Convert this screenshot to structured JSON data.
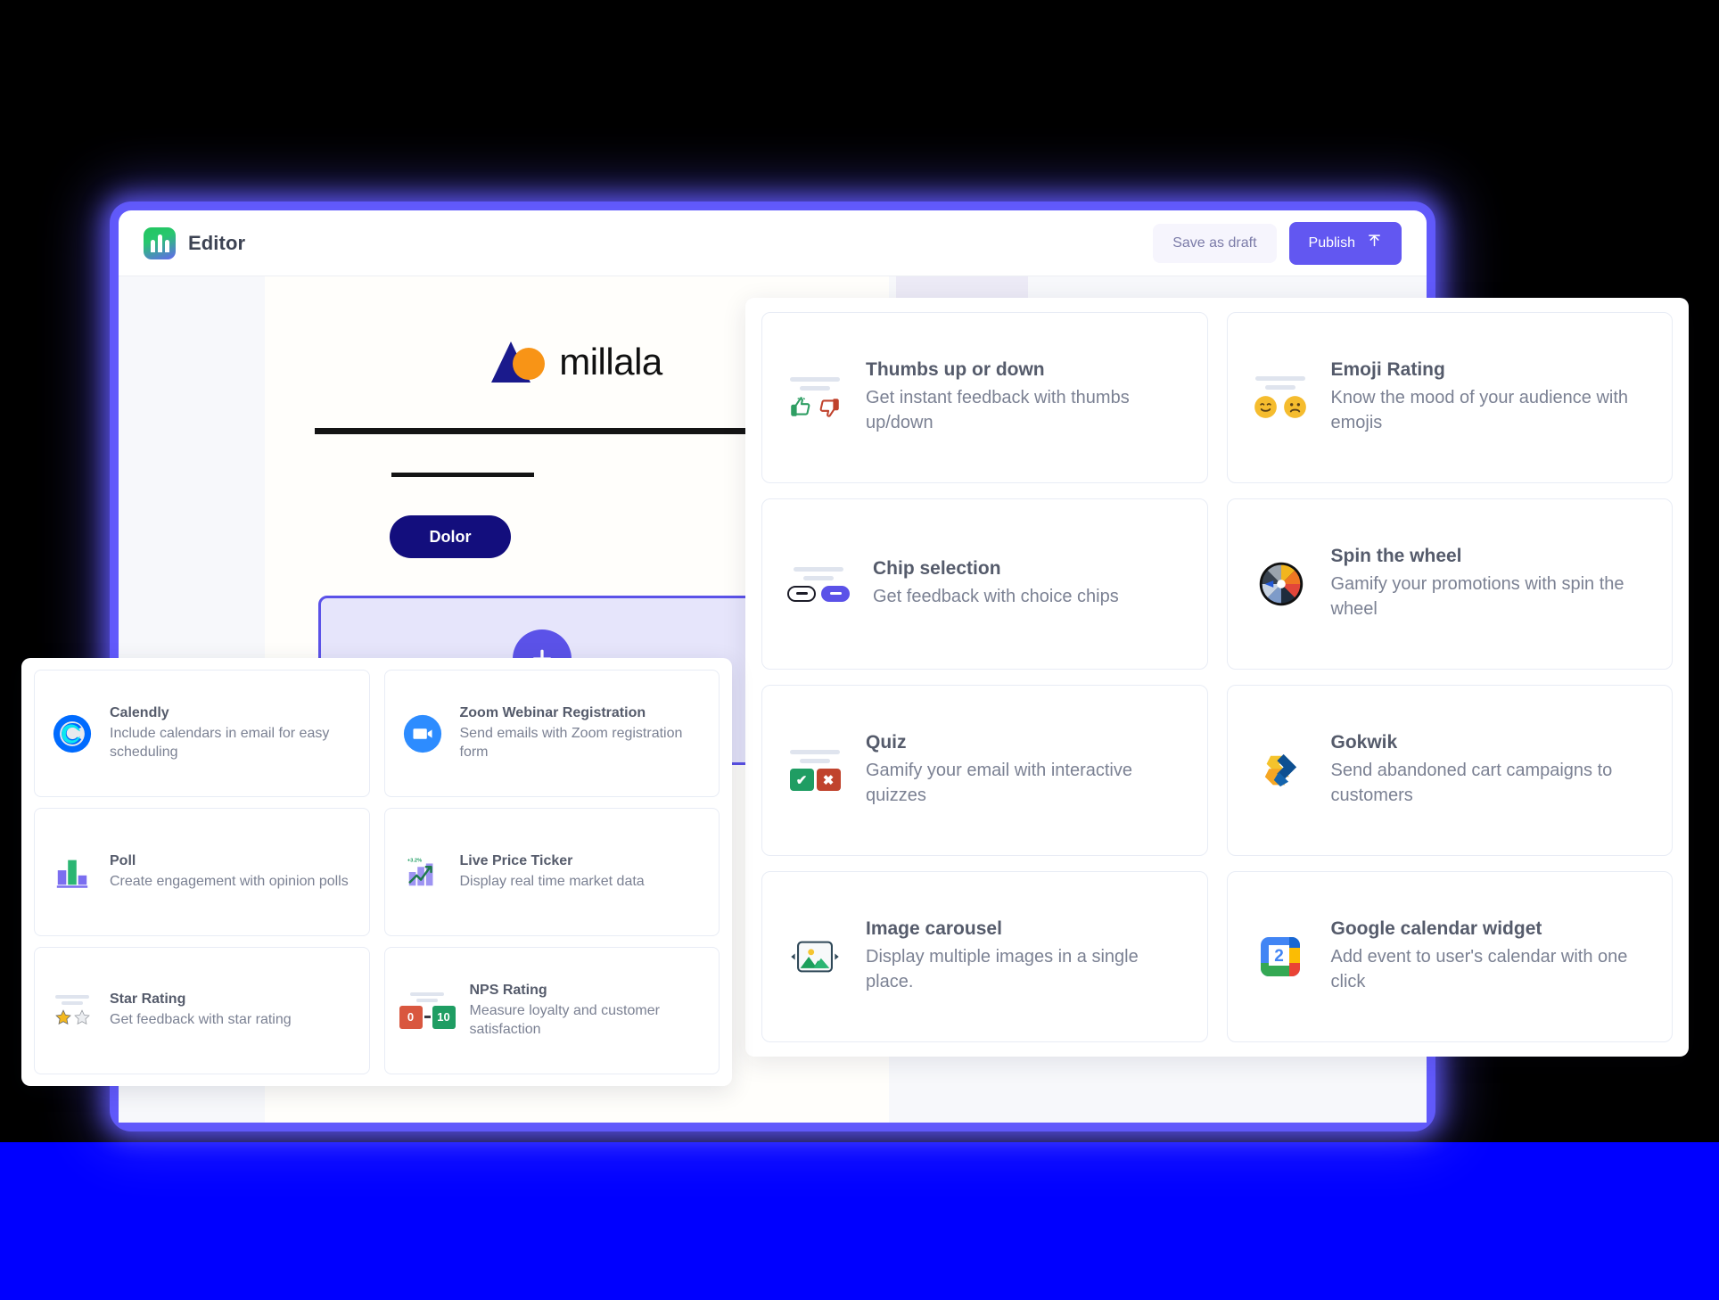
{
  "app": {
    "title": "Editor",
    "logo_icon": "millala-app-logo-icon",
    "accent_color": "#6257f1",
    "glow_color": "#635bff"
  },
  "header": {
    "save_draft_label": "Save as draft",
    "publish_label": "Publish",
    "publish_icon": "upload-arrow-icon"
  },
  "canvas": {
    "brand_name": "millala",
    "brand_triangle_color": "#1a1a8c",
    "brand_circle_color": "#f89416",
    "cta_label": "Dolor",
    "cta_color": "#130e7d",
    "add_block_icon": "plus-icon"
  },
  "widget_panel": {
    "cards": [
      {
        "title": "Thumbs up or down",
        "desc": "Get instant feedback with thumbs up/down",
        "icon": "thumbs-up-down-icon"
      },
      {
        "title": "Emoji Rating",
        "desc": "Know the mood of your audience with emojis",
        "icon": "emoji-rating-icon",
        "emoji_happy": "😊",
        "emoji_sad": "☹"
      },
      {
        "title": "Chip selection",
        "desc": "Get feedback with choice chips",
        "icon": "chip-selection-icon"
      },
      {
        "title": "Spin the wheel",
        "desc": "Gamify your promotions with spin the wheel",
        "icon": "spin-wheel-icon"
      },
      {
        "title": "Quiz",
        "desc": "Gamify your email with interactive quizzes",
        "icon": "quiz-check-cross-icon",
        "check_glyph": "✔",
        "cross_glyph": "✖"
      },
      {
        "title": "Gokwik",
        "desc": "Send abandoned cart campaigns to customers",
        "icon": "gokwik-logo-icon"
      },
      {
        "title": "Image carousel",
        "desc": "Display multiple images in a single place.",
        "icon": "image-carousel-icon"
      },
      {
        "title": "Google calendar widget",
        "desc": "Add event to user's calendar with one click",
        "icon": "google-calendar-icon",
        "day_number": "2"
      }
    ]
  },
  "integrations_panel": {
    "cards": [
      {
        "title": "Calendly",
        "desc": "Include calendars in email for easy scheduling",
        "icon": "calendly-logo-icon"
      },
      {
        "title": "Zoom Webinar Registration",
        "desc": "Send emails with Zoom registration form",
        "icon": "zoom-logo-icon"
      },
      {
        "title": "Poll",
        "desc": "Create engagement with opinion polls",
        "icon": "poll-bar-chart-icon"
      },
      {
        "title": "Live Price Ticker",
        "desc": "Display real time market data",
        "icon": "live-price-ticker-icon",
        "badge": "+3.2%"
      },
      {
        "title": "Star Rating",
        "desc": "Get feedback with star rating",
        "icon": "star-rating-icon",
        "star_filled": "★",
        "star_empty": "☆"
      },
      {
        "title": "NPS Rating",
        "desc": "Measure loyalty and customer satisfaction",
        "icon": "nps-rating-icon",
        "low": "0",
        "high": "10"
      }
    ]
  }
}
